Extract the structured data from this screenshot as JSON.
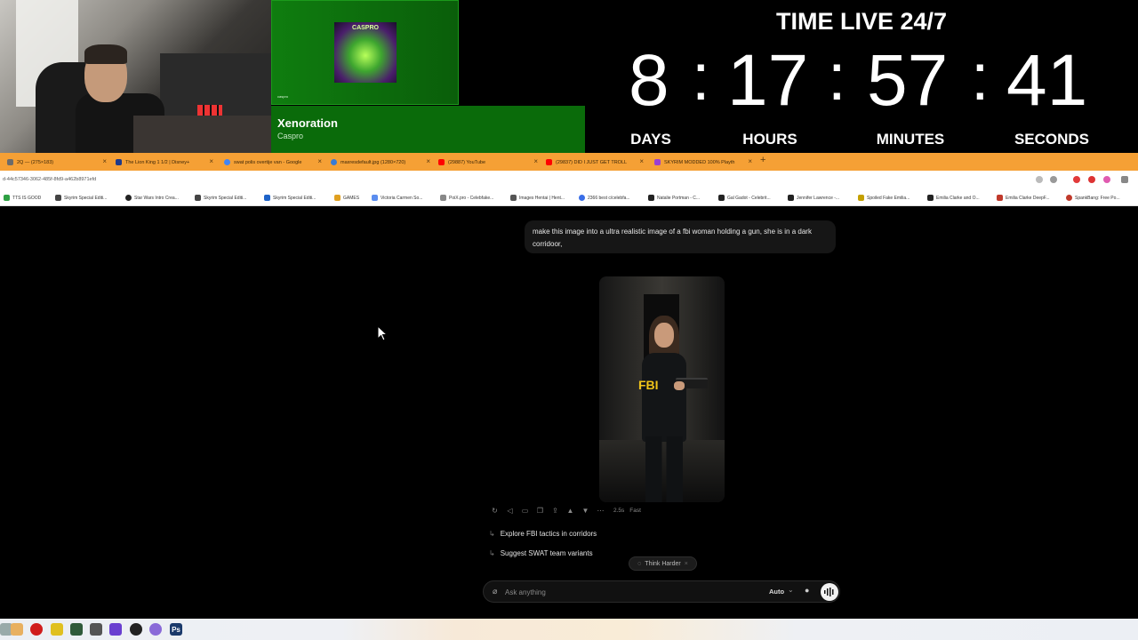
{
  "now_playing": {
    "cover_title": "CASPRO",
    "tiny_text": "caspro",
    "track": "Xenoration",
    "artist": "Caspro"
  },
  "timer": {
    "title": "TIME LIVE 24/7",
    "days": "8",
    "hours": "17",
    "minutes": "57",
    "seconds": "41",
    "days_label": "DAYS",
    "hours_label": "HOURS",
    "minutes_label": "MINUTES",
    "seconds_label": "SECONDS"
  },
  "browser": {
    "tabs": [
      {
        "label": "2Q — (275×183)",
        "icon": "gear-icon",
        "color": "#6b6b6b"
      },
      {
        "label": "The Lion King 1 1/2 | Disney+",
        "icon": "disney-icon",
        "color": "#1f3a8a"
      },
      {
        "label": "swat polis overtije van - Google",
        "icon": "google-icon",
        "color": "#4285f4"
      },
      {
        "label": "maxresdefault.jpg (1280×720)",
        "icon": "image-icon",
        "color": "#3a7bd5"
      },
      {
        "label": "(29887) YouTube",
        "icon": "youtube-icon",
        "color": "#ff0000"
      },
      {
        "label": "(29837) DID I JUST GET TROLL",
        "icon": "youtube-icon",
        "color": "#ff0000"
      },
      {
        "label": "SKYRIM MODDED 100% Playth",
        "icon": "youtube-icon",
        "color": "#9b3fd0"
      }
    ],
    "url": "d-44c57346-3062-485f-8fd9-a462b8971efd",
    "bookmarks": [
      {
        "label": "TTS IS GOOD",
        "color": "#2ea043"
      },
      {
        "label": "Skyrim Special Editi...",
        "color": "#444"
      },
      {
        "label": "Star Wars Intro Crea...",
        "color": "#222"
      },
      {
        "label": "Skyrim Special Editi...",
        "color": "#444"
      },
      {
        "label": "Skyrim Special Editi...",
        "color": "#1e63c8"
      },
      {
        "label": "GAMES",
        "color": "#e0a020"
      },
      {
        "label": "Victoria Carmen So...",
        "color": "#5b8def"
      },
      {
        "label": "PoiX.pro - Celebfake...",
        "color": "#888"
      },
      {
        "label": "Images Hentai | Hent...",
        "color": "#555"
      },
      {
        "label": "2366 best c/celebfa...",
        "color": "#3a6ee8"
      },
      {
        "label": "Natalie Portman - C...",
        "color": "#222"
      },
      {
        "label": "Gal Gadot - Celebrit...",
        "color": "#222"
      },
      {
        "label": "Jennifer Lawrence -...",
        "color": "#222"
      },
      {
        "label": "Spoiled Fake Emilia...",
        "color": "#c4a000"
      },
      {
        "label": "Emilia Clarke and O...",
        "color": "#222"
      },
      {
        "label": "Emilia Clarke DeepF...",
        "color": "#c0392b"
      },
      {
        "label": "SpankBang: Free Po...",
        "color": "#c0392b"
      }
    ]
  },
  "chat": {
    "user_message": "make this image into a ultra realistic image of a fbi woman holding a gun, she is in a dark corridoor,",
    "image_text": "FBI",
    "meta_time": "2.5s",
    "meta_mode": "Fast",
    "suggestions": [
      "Explore FBI tactics in corridors",
      "Suggest SWAT team variants"
    ],
    "think_harder": "Think Harder",
    "placeholder": "Ask anything",
    "mode": "Auto"
  },
  "colors": {
    "tab_bar": "#f5a035",
    "now_playing_green": "#0a6b0a",
    "fbi_yellow": "#f0c419"
  }
}
